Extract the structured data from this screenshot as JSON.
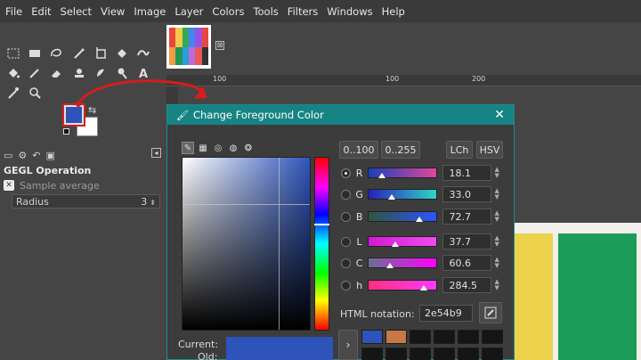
{
  "menubar": [
    "File",
    "Edit",
    "Select",
    "View",
    "Image",
    "Layer",
    "Colors",
    "Tools",
    "Filters",
    "Windows",
    "Help"
  ],
  "toolbox": {
    "tool_icons": [
      "rect-select-icon",
      "ellipse-select-icon",
      "free-select-icon",
      "fuzzy-select-icon",
      "crop-icon",
      "unified-transform-icon",
      "warp-icon",
      "bucket-fill-icon",
      "paintbrush-icon",
      "eraser-icon",
      "clone-icon",
      "smudge-icon",
      "dodge-icon",
      "text-icon",
      "color-picker-icon",
      "zoom-icon"
    ],
    "fg_color": "#2e54b9",
    "bg_color": "#ffffff"
  },
  "tool_options": {
    "title": "GEGL Operation",
    "sample_label": "Sample average",
    "radius_label": "Radius",
    "radius_value": "3"
  },
  "ruler": {
    "ticks": [
      "100",
      "100",
      "200"
    ]
  },
  "dialog": {
    "title": "Change Foreground Color",
    "range_buttons": [
      "0..100",
      "0..255"
    ],
    "model_buttons": [
      "LCh",
      "HSV"
    ],
    "channels": [
      {
        "label": "R",
        "value": "18.1",
        "pos": 0.181,
        "colors": [
          "#1a3fb9",
          "#e0479f"
        ],
        "selected": true
      },
      {
        "label": "G",
        "value": "33.0",
        "pos": 0.33,
        "colors": [
          "#2a1fb9",
          "#2ed6c8"
        ],
        "selected": false
      },
      {
        "label": "B",
        "value": "72.7",
        "pos": 0.727,
        "colors": [
          "#2e5440",
          "#2e54ff"
        ],
        "selected": false
      },
      {
        "label": "L",
        "value": "37.7",
        "pos": 0.377,
        "colors": [
          "#d21ad2",
          "#f04bf0"
        ],
        "selected": false
      },
      {
        "label": "C",
        "value": "60.6",
        "pos": 0.3,
        "colors": [
          "#6a6f92",
          "#ff00ff"
        ],
        "selected": false
      },
      {
        "label": "h",
        "value": "284.5",
        "pos": 0.79,
        "colors": [
          "#ff2f7d",
          "#ff3aff"
        ],
        "selected": false
      }
    ],
    "html_label": "HTML notation:",
    "html_value": "2e54b9",
    "current_label": "Current:",
    "old_label": "Old:",
    "current_color": "#2e54b9",
    "history": [
      "#2e54b9",
      "#c87844",
      "#151515",
      "#151515",
      "#151515",
      "#151515",
      "#151515",
      "#151515",
      "#151515",
      "#151515",
      "#151515",
      "#151515"
    ]
  }
}
